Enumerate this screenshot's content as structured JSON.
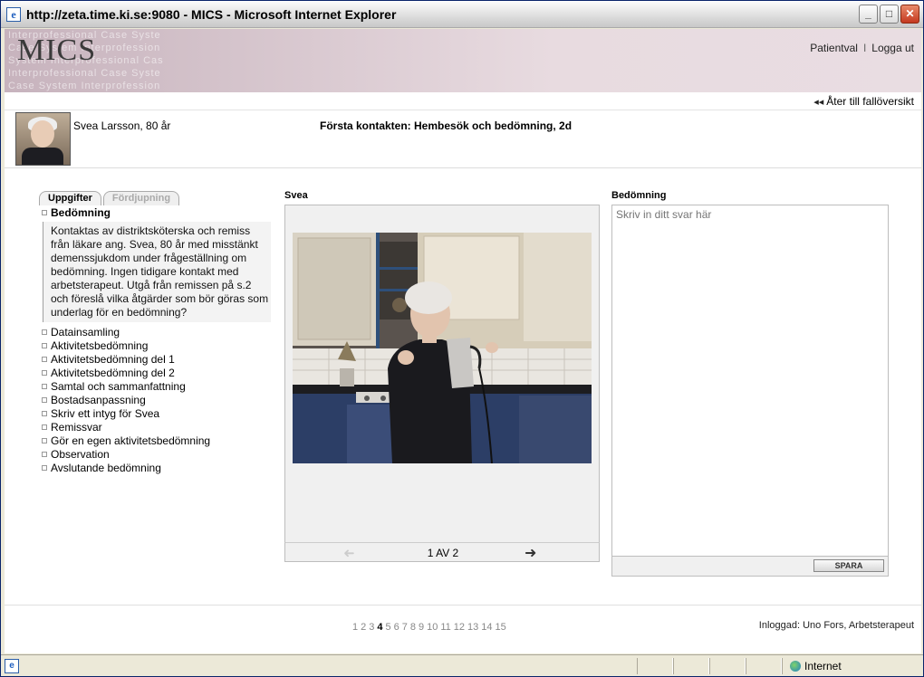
{
  "window": {
    "title": "http://zeta.time.ki.se:9080 - MICS - Microsoft Internet Explorer",
    "minimize": "_",
    "maximize": "□",
    "close": "✕"
  },
  "header": {
    "logo": "MICS",
    "watermark_lines": [
      "Interprofessional  Case  Syste",
      "Case  System  Interprofession",
      "System  Interprofessional  Cas",
      "Interprofessional  Case  Syste",
      "Case  System  Interprofession"
    ],
    "nav": {
      "patient_select": "Patientval",
      "separator": "I",
      "logout": "Logga ut"
    }
  },
  "back_link": {
    "arrow": "◂◂",
    "label": "Åter till fallöversikt"
  },
  "patient": {
    "name": "Svea Larsson, 80 år",
    "contact_title": "Första kontakten: Hembesök och bedömning, 2d"
  },
  "tasks": {
    "tabs": [
      {
        "label": "Uppgifter",
        "active": true
      },
      {
        "label": "Fördjupning",
        "active": false
      }
    ],
    "open_item": "Bedömning",
    "open_description": "Kontaktas av distriktsköterska och remiss från läkare ang. Svea, 80 år med misstänkt demenssjukdom under frågeställning om bedömning. Ingen tidigare kontakt med arbetsterapeut. Utgå från remissen på s.2 och föreslå vilka åtgärder som bör göras som underlag för en bedömning?",
    "items": [
      "Datainsamling",
      "Aktivitetsbedömning",
      "Aktivitetsbedömning del 1",
      "Aktivitetsbedömning del 2",
      "Samtal och sammanfattning",
      "Bostadsanpassning",
      "Skriv ett intyg för Svea",
      "Remissvar",
      "Gör en egen aktivitetsbedömning",
      "Observation",
      "Avslutande bedömning"
    ]
  },
  "media": {
    "title": "Svea",
    "prev_icon": "prev-arrow-icon",
    "next_icon": "next-arrow-icon",
    "page_indicator": "1 AV 2"
  },
  "assessment": {
    "title": "Bedömning",
    "placeholder": "Skriv in ditt svar här",
    "save_label": "SPARA"
  },
  "footer": {
    "pages": [
      "1",
      "2",
      "3",
      "4",
      "5",
      "6",
      "7",
      "8",
      "9",
      "10",
      "11",
      "12",
      "13",
      "14",
      "15"
    ],
    "current_page": "4",
    "logged_in": "Inloggad: Uno Fors, Arbetsterapeut"
  },
  "statusbar": {
    "zone": "Internet"
  }
}
